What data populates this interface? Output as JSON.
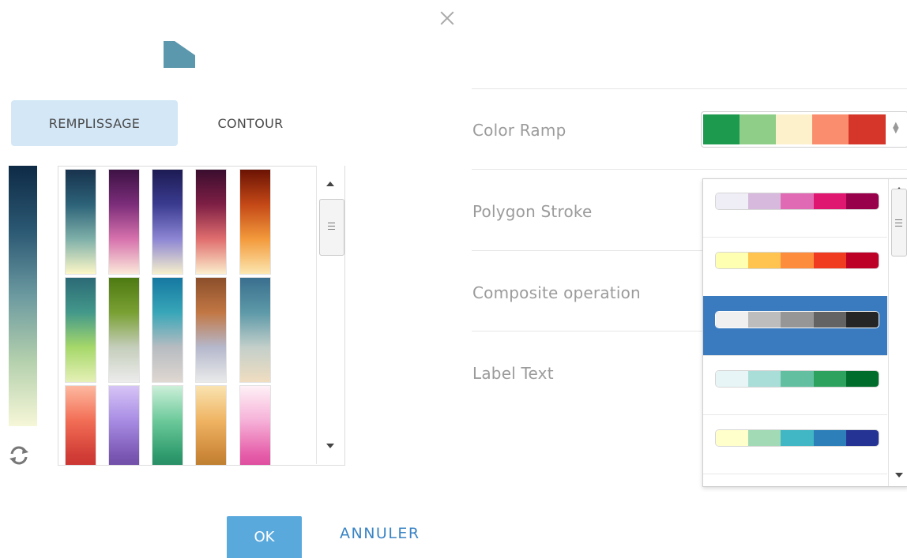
{
  "dialog": {
    "close_icon": "close-icon",
    "preview_color": "#5b97ad"
  },
  "tabs": [
    {
      "label": "REMPLISSAGE",
      "active": true
    },
    {
      "label": "CONTOUR",
      "active": false
    }
  ],
  "current_ramp": [
    "#0e2a45",
    "#2b5873",
    "#6c9aa0",
    "#b4d0ad",
    "#f6f7d8"
  ],
  "ramp_grid": [
    [
      "#18324d",
      "#2c6278",
      "#7fb0a9",
      "#fdf7c7"
    ],
    [
      "#3d1244",
      "#7c2d7a",
      "#d772ad",
      "#fbe9d9"
    ],
    [
      "#1d1b53",
      "#3a3b90",
      "#8d86d4",
      "#f6efcb"
    ],
    [
      "#3a0d2e",
      "#7e1f45",
      "#e06e6e",
      "#fbeecd"
    ],
    [
      "#6b1304",
      "#c44817",
      "#f39a3c",
      "#fce6b0"
    ],
    [
      "#2c6a76",
      "#43988a",
      "#a6d86a",
      "#e5f0b6"
    ],
    [
      "#4d7a12",
      "#79a033",
      "#c5cebb",
      "#ececec"
    ],
    [
      "#1578a1",
      "#38a6b8",
      "#b7bcc1",
      "#dfd7d1"
    ],
    [
      "#8b4f2b",
      "#c27744",
      "#b5b8cc",
      "#e9eaea"
    ],
    [
      "#3a6f8e",
      "#5d99a8",
      "#c3cfca",
      "#f0ddc0"
    ],
    [
      "#fdb9a0",
      "#f26e55",
      "#d13d36",
      "#c1262d"
    ],
    [
      "#d7c4f6",
      "#a88ce4",
      "#7a57b3",
      "#5a3e8d"
    ],
    [
      "#ccefd9",
      "#6cc99a",
      "#2f9b6d",
      "#1b6f55"
    ],
    [
      "#f9e3b0",
      "#efb463",
      "#cc8838",
      "#9a6a22"
    ],
    [
      "#fef1f6",
      "#f6b1d8",
      "#e55ca8",
      "#cf2a8a"
    ]
  ],
  "buttons": {
    "ok": "OK",
    "cancel": "ANNULER"
  },
  "properties": [
    {
      "label": "Color Ramp"
    },
    {
      "label": "Polygon Stroke"
    },
    {
      "label": "Composite operation"
    },
    {
      "label": "Label Text"
    }
  ],
  "color_ramp_select": {
    "selected": [
      "#1d9a4e",
      "#8fce88",
      "#fdf1cc",
      "#f98d6d",
      "#d6362a"
    ]
  },
  "dropdown_options": [
    {
      "colors": [
        "#efedf5",
        "#d6b9dd",
        "#e06bb4",
        "#df1771",
        "#99004c"
      ],
      "selected": false
    },
    {
      "colors": [
        "#ffffb2",
        "#fec44f",
        "#fd8d3c",
        "#f03b20",
        "#bd0026"
      ],
      "selected": false
    },
    {
      "colors": [
        "#f0f0f0",
        "#bdbdbd",
        "#969696",
        "#636363",
        "#252525"
      ],
      "selected": true
    },
    {
      "colors": [
        "#e8f5f6",
        "#a9ded8",
        "#62c0a0",
        "#2da25f",
        "#006d2c"
      ],
      "selected": false
    },
    {
      "colors": [
        "#ffffcc",
        "#a1dab4",
        "#41b6c4",
        "#2c7fb8",
        "#253494"
      ],
      "selected": false
    },
    {
      "colors": [
        "#99004c",
        "#df1771",
        "#e06bb4",
        "#d6b9dd",
        "#efedf5"
      ],
      "selected": false
    }
  ]
}
